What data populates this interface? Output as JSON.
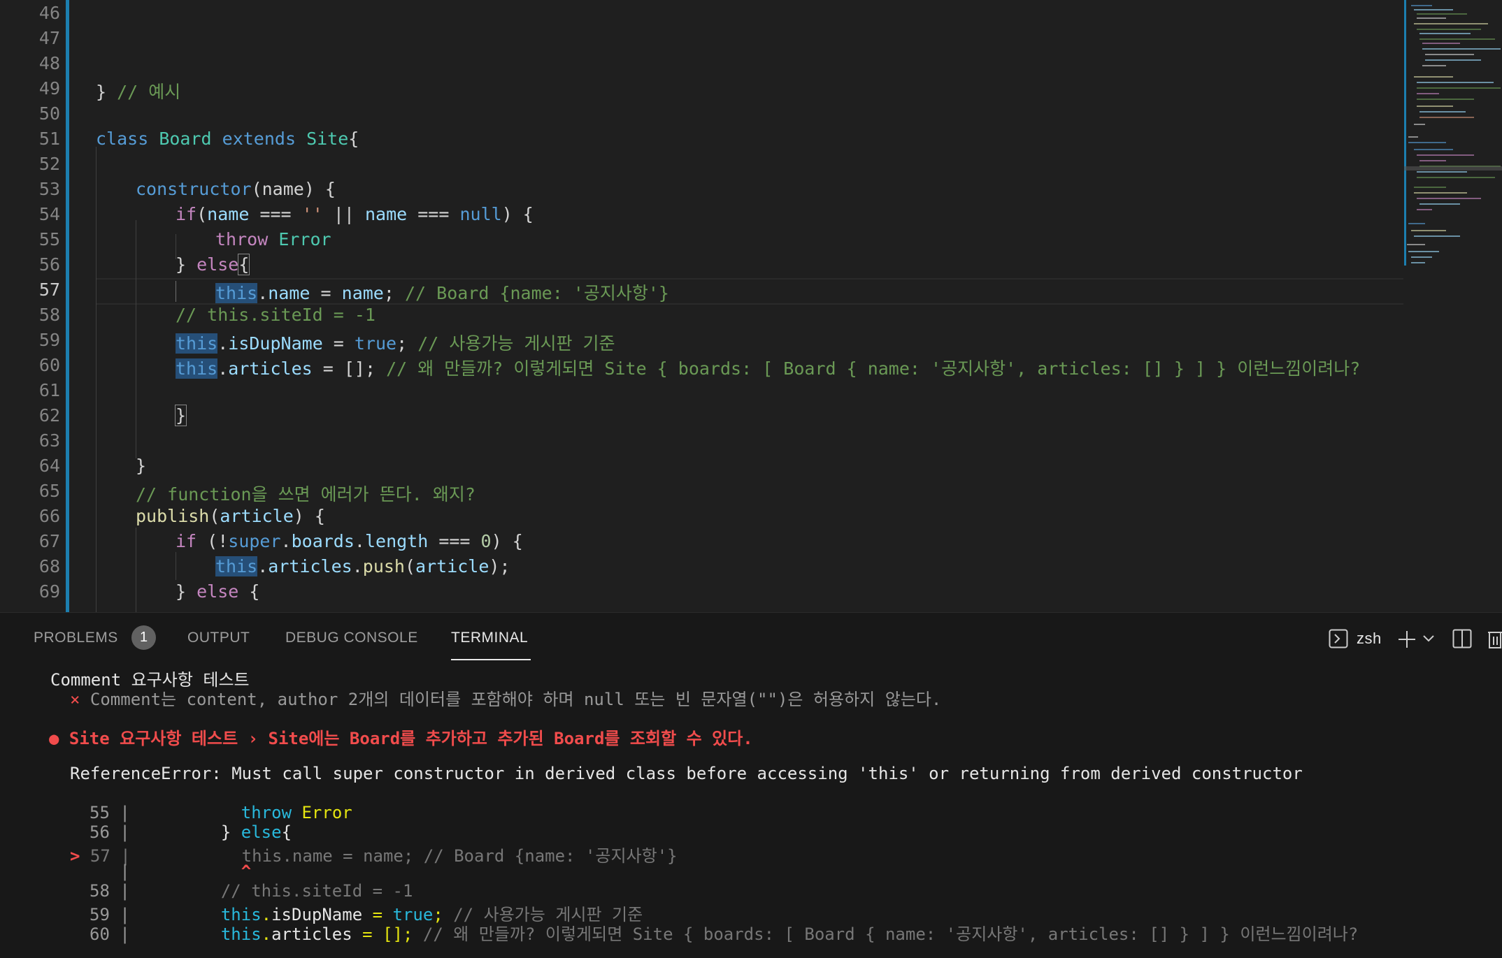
{
  "editor": {
    "line_numbers": [
      "46",
      "47",
      "48",
      "49",
      "50",
      "51",
      "52",
      "53",
      "54",
      "55",
      "56",
      "57",
      "58",
      "59",
      "60",
      "61",
      "62",
      "63",
      "64",
      "65",
      "66",
      "67",
      "68",
      "69"
    ],
    "active_line": "57",
    "code": {
      "l49_brace": "}",
      "l49_comment": "// 예시",
      "l51_class": "class",
      "l51_name": "Board",
      "l51_extends": "extends",
      "l51_parent": "Site",
      "l51_brace": "{",
      "l53_ctor": "constructor",
      "l53_params": "(name) {",
      "l54_if": "if",
      "l54_open": "(",
      "l54_name1": "name",
      "l54_eq1": " === ",
      "l54_str": "''",
      "l54_or": " || ",
      "l54_name2": "name",
      "l54_eq2": " === ",
      "l54_null": "null",
      "l54_close": ") {",
      "l55_throw": "throw",
      "l55_error": "Error",
      "l56_brace": "} ",
      "l56_else": "else",
      "l56_open": "{",
      "l57_this": "this",
      "l57_rest1": ".",
      "l57_name": "name",
      "l57_assign": " = ",
      "l57_name2": "name",
      "l57_semi": "; ",
      "l57_comment": "// Board {name: '공지사항'}",
      "l58_comment": "// this.siteId = -1",
      "l59_this": "this",
      "l59_dot": ".",
      "l59_prop": "isDupName",
      "l59_assign": " = ",
      "l59_true": "true",
      "l59_semi": "; ",
      "l59_comment": "// 사용가능 게시판 기준",
      "l60_this": "this",
      "l60_dot": ".",
      "l60_prop": "articles",
      "l60_assign": " = []; ",
      "l60_comment": "// 왜 만들까? 이렇게되면 Site { boards: [ Board { name: '공지사항', articles: [] } ] } 이런느낌이려나?",
      "l62_brace": "}",
      "l64_brace": "}",
      "l65_comment": "// function을 쓰면 에러가 뜬다. 왜지?",
      "l66_fn": "publish",
      "l66_open": "(",
      "l66_param": "article",
      "l66_close": ") {",
      "l67_if": "if",
      "l67_open": " (!",
      "l67_super": "super",
      "l67_dot1": ".",
      "l67_boards": "boards",
      "l67_dot2": ".",
      "l67_length": "length",
      "l67_eq": " === ",
      "l67_zero": "0",
      "l67_close": ") {",
      "l68_this": "this",
      "l68_dot1": ".",
      "l68_articles": "articles",
      "l68_dot2": ".",
      "l68_push": "push",
      "l68_open": "(",
      "l68_arg": "article",
      "l68_close": ");",
      "l69_brace": "} ",
      "l69_else": "else",
      "l69_open": " {"
    }
  },
  "panel": {
    "tabs": [
      {
        "label": "PROBLEMS"
      },
      {
        "label": "OUTPUT"
      },
      {
        "label": "DEBUG CONSOLE"
      },
      {
        "label": "TERMINAL"
      }
    ],
    "problems_count": "1",
    "active_tab": "TERMINAL",
    "shell_name": "zsh"
  },
  "terminal": {
    "suite1_title": "Comment 요구사항 테스트",
    "fail_mark": "×",
    "suite1_test": "Comment는 content, author 2개의 데이터를 포함해야 하며 null 또는 빈 문자열(\"\")은 허용하지 않는다.",
    "bullet": "●",
    "suite2_title": "Site 요구사항 테스트 › Site에는 Board를 추가하고 추가된 Board를 조회할 수 있다.",
    "error_msg": "ReferenceError: Must call super constructor in derived class before accessing 'this' or returning from derived constructor",
    "snippet": {
      "n55": "55",
      "n56": "56",
      "n57": "57",
      "n58": "58",
      "n59": "59",
      "n60": "60",
      "pipe": "|",
      "arrow": ">",
      "caret": "^",
      "s55_throw": "throw",
      "s55_error": "Error",
      "s56_brace": "} ",
      "s56_else": "else",
      "s56_open": "{",
      "s57_this": "this",
      "s57_rest": ".name = name; // Board {name: '공지사항'}",
      "s58": "// this.siteId = -1",
      "s59_this": "this",
      "s59_dot": ".",
      "s59_prop": "isDupName",
      "s59_eq": " = ",
      "s59_true": "true",
      "s59_semi": ";",
      "s59_comment": " // 사용가능 게시판 기준",
      "s60_this": "this",
      "s60_dot": ".",
      "s60_prop": "articles",
      "s60_eq": " = ",
      "s60_arr": "[];",
      "s60_comment": " // 왜 만들까? 이렇게되면 Site { boards: [ Board { name: '공지사항', articles: [] } ] } 이런느낌이려나?"
    }
  },
  "colors": {
    "editor_bg": "#1f1f1f",
    "panel_bg": "#181818",
    "keyword": "#569cd6",
    "control": "#c586c0",
    "class": "#4ec9b0",
    "function": "#dcdcaa",
    "variable": "#9cdcfe",
    "string": "#ce9178",
    "comment": "#6a9955",
    "error_red": "#f14c4c"
  },
  "icons": [
    "terminal-shell-icon",
    "add-terminal-icon",
    "chevron-down-icon",
    "split-terminal-icon",
    "trash-icon"
  ]
}
